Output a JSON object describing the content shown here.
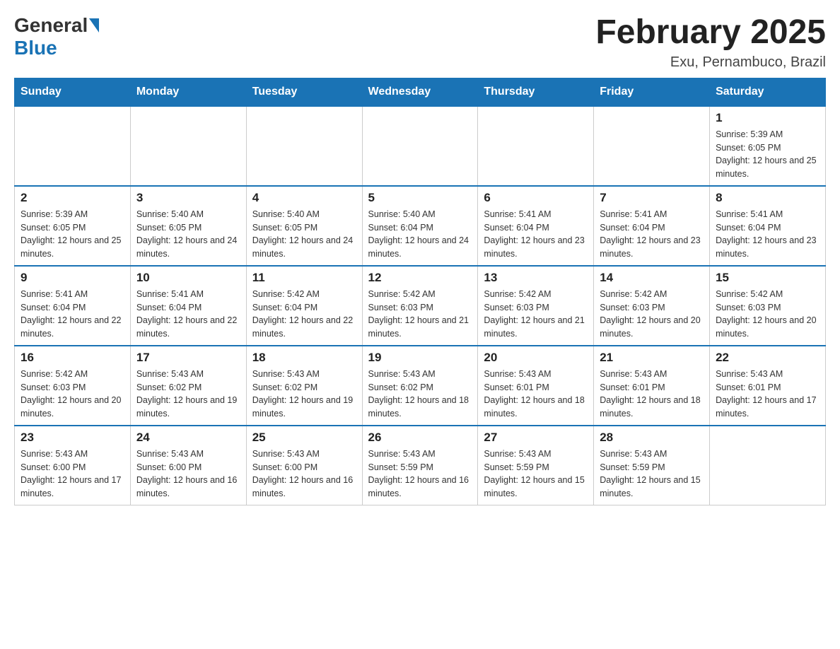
{
  "logo": {
    "general": "General",
    "blue": "Blue"
  },
  "title": "February 2025",
  "subtitle": "Exu, Pernambuco, Brazil",
  "days_of_week": [
    "Sunday",
    "Monday",
    "Tuesday",
    "Wednesday",
    "Thursday",
    "Friday",
    "Saturday"
  ],
  "weeks": [
    [
      {
        "day": "",
        "info": ""
      },
      {
        "day": "",
        "info": ""
      },
      {
        "day": "",
        "info": ""
      },
      {
        "day": "",
        "info": ""
      },
      {
        "day": "",
        "info": ""
      },
      {
        "day": "",
        "info": ""
      },
      {
        "day": "1",
        "info": "Sunrise: 5:39 AM\nSunset: 6:05 PM\nDaylight: 12 hours and 25 minutes."
      }
    ],
    [
      {
        "day": "2",
        "info": "Sunrise: 5:39 AM\nSunset: 6:05 PM\nDaylight: 12 hours and 25 minutes."
      },
      {
        "day": "3",
        "info": "Sunrise: 5:40 AM\nSunset: 6:05 PM\nDaylight: 12 hours and 24 minutes."
      },
      {
        "day": "4",
        "info": "Sunrise: 5:40 AM\nSunset: 6:05 PM\nDaylight: 12 hours and 24 minutes."
      },
      {
        "day": "5",
        "info": "Sunrise: 5:40 AM\nSunset: 6:04 PM\nDaylight: 12 hours and 24 minutes."
      },
      {
        "day": "6",
        "info": "Sunrise: 5:41 AM\nSunset: 6:04 PM\nDaylight: 12 hours and 23 minutes."
      },
      {
        "day": "7",
        "info": "Sunrise: 5:41 AM\nSunset: 6:04 PM\nDaylight: 12 hours and 23 minutes."
      },
      {
        "day": "8",
        "info": "Sunrise: 5:41 AM\nSunset: 6:04 PM\nDaylight: 12 hours and 23 minutes."
      }
    ],
    [
      {
        "day": "9",
        "info": "Sunrise: 5:41 AM\nSunset: 6:04 PM\nDaylight: 12 hours and 22 minutes."
      },
      {
        "day": "10",
        "info": "Sunrise: 5:41 AM\nSunset: 6:04 PM\nDaylight: 12 hours and 22 minutes."
      },
      {
        "day": "11",
        "info": "Sunrise: 5:42 AM\nSunset: 6:04 PM\nDaylight: 12 hours and 22 minutes."
      },
      {
        "day": "12",
        "info": "Sunrise: 5:42 AM\nSunset: 6:03 PM\nDaylight: 12 hours and 21 minutes."
      },
      {
        "day": "13",
        "info": "Sunrise: 5:42 AM\nSunset: 6:03 PM\nDaylight: 12 hours and 21 minutes."
      },
      {
        "day": "14",
        "info": "Sunrise: 5:42 AM\nSunset: 6:03 PM\nDaylight: 12 hours and 20 minutes."
      },
      {
        "day": "15",
        "info": "Sunrise: 5:42 AM\nSunset: 6:03 PM\nDaylight: 12 hours and 20 minutes."
      }
    ],
    [
      {
        "day": "16",
        "info": "Sunrise: 5:42 AM\nSunset: 6:03 PM\nDaylight: 12 hours and 20 minutes."
      },
      {
        "day": "17",
        "info": "Sunrise: 5:43 AM\nSunset: 6:02 PM\nDaylight: 12 hours and 19 minutes."
      },
      {
        "day": "18",
        "info": "Sunrise: 5:43 AM\nSunset: 6:02 PM\nDaylight: 12 hours and 19 minutes."
      },
      {
        "day": "19",
        "info": "Sunrise: 5:43 AM\nSunset: 6:02 PM\nDaylight: 12 hours and 18 minutes."
      },
      {
        "day": "20",
        "info": "Sunrise: 5:43 AM\nSunset: 6:01 PM\nDaylight: 12 hours and 18 minutes."
      },
      {
        "day": "21",
        "info": "Sunrise: 5:43 AM\nSunset: 6:01 PM\nDaylight: 12 hours and 18 minutes."
      },
      {
        "day": "22",
        "info": "Sunrise: 5:43 AM\nSunset: 6:01 PM\nDaylight: 12 hours and 17 minutes."
      }
    ],
    [
      {
        "day": "23",
        "info": "Sunrise: 5:43 AM\nSunset: 6:00 PM\nDaylight: 12 hours and 17 minutes."
      },
      {
        "day": "24",
        "info": "Sunrise: 5:43 AM\nSunset: 6:00 PM\nDaylight: 12 hours and 16 minutes."
      },
      {
        "day": "25",
        "info": "Sunrise: 5:43 AM\nSunset: 6:00 PM\nDaylight: 12 hours and 16 minutes."
      },
      {
        "day": "26",
        "info": "Sunrise: 5:43 AM\nSunset: 5:59 PM\nDaylight: 12 hours and 16 minutes."
      },
      {
        "day": "27",
        "info": "Sunrise: 5:43 AM\nSunset: 5:59 PM\nDaylight: 12 hours and 15 minutes."
      },
      {
        "day": "28",
        "info": "Sunrise: 5:43 AM\nSunset: 5:59 PM\nDaylight: 12 hours and 15 minutes."
      },
      {
        "day": "",
        "info": ""
      }
    ]
  ]
}
